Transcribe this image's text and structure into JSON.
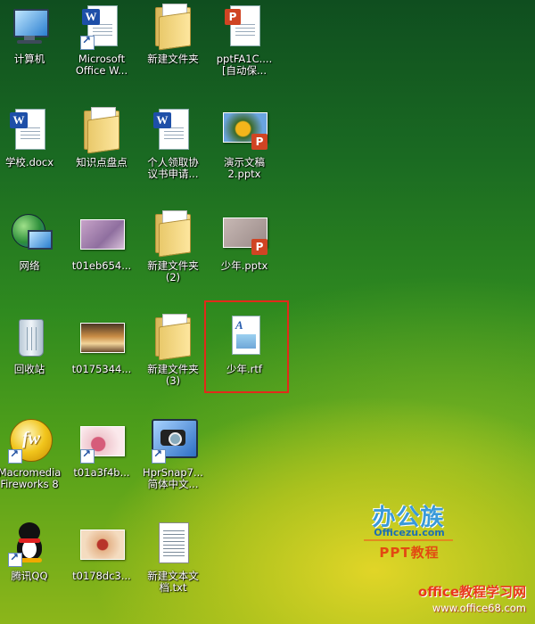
{
  "desktop": {
    "icons": [
      {
        "label": "计算机"
      },
      {
        "label": "Microsoft\nOffice W..."
      },
      {
        "label": "新建文件夹"
      },
      {
        "label": "pptFA1C....\n[自动保..."
      },
      {
        "label": "学校.docx"
      },
      {
        "label": "知识点盘点"
      },
      {
        "label": "个人领取协\n议书申请..."
      },
      {
        "label": "演示文稿\n2.pptx"
      },
      {
        "label": "网络"
      },
      {
        "label": "t01eb654..."
      },
      {
        "label": "新建文件夹\n(2)"
      },
      {
        "label": "少年.pptx"
      },
      {
        "label": "回收站"
      },
      {
        "label": "t0175344..."
      },
      {
        "label": "新建文件夹\n(3)"
      },
      {
        "label": "少年.rtf"
      },
      {
        "label": "Macromedia\nFireworks 8"
      },
      {
        "label": "t01a3f4b..."
      },
      {
        "label": "HprSnap7...\n简体中文..."
      },
      {
        "label": "腾讯QQ"
      },
      {
        "label": "t0178dc3..."
      },
      {
        "label": "新建文本文\n档.txt"
      }
    ]
  },
  "watermark": {
    "logo": "办公族",
    "domain": "Officezu.com",
    "tagline": "PPT教程",
    "site": "office教程学习网",
    "url": "www.office68.com"
  },
  "colors": {
    "highlight_border": "#e22a1a",
    "watermark_blue": "#3a9ad9",
    "watermark_orange": "#e24a12"
  }
}
